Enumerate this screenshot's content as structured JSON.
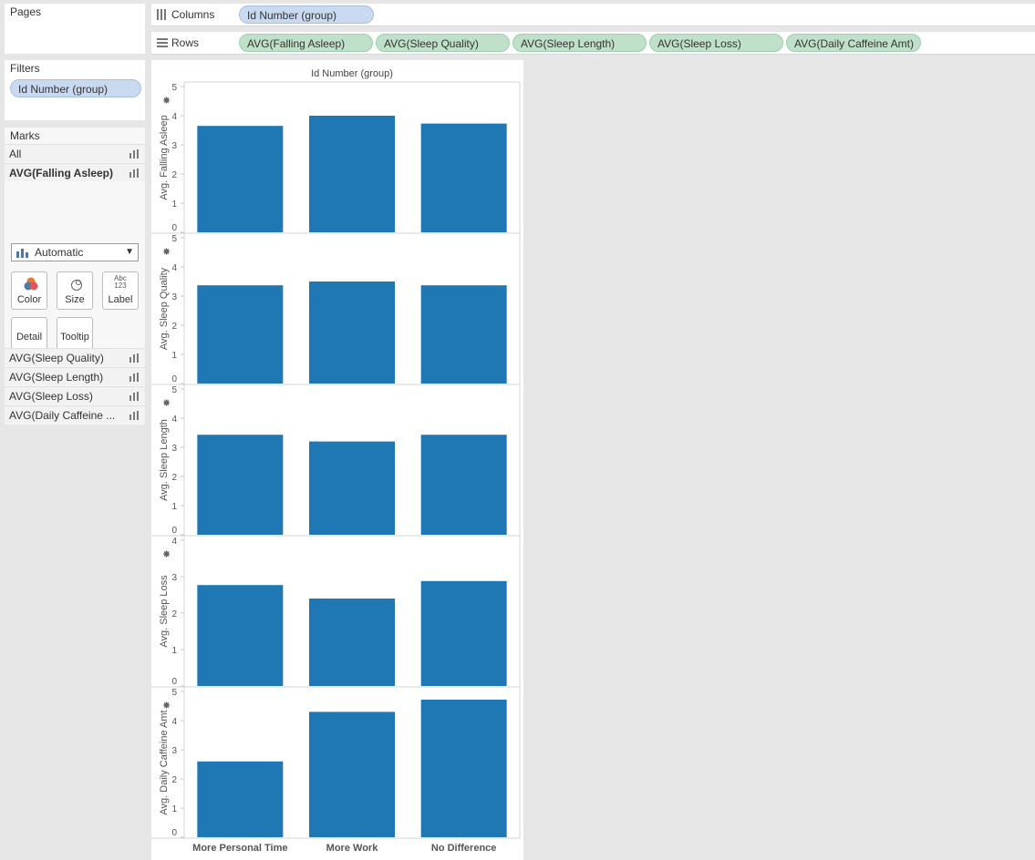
{
  "pages": {
    "title": "Pages"
  },
  "filters": {
    "title": "Filters",
    "pills": [
      "Id Number (group)"
    ]
  },
  "marks": {
    "title": "Marks",
    "rows_top": [
      "All",
      "AVG(Falling Asleep)"
    ],
    "mark_type": "Automatic",
    "buttons": {
      "color": "Color",
      "size": "Size",
      "label": "Label",
      "label_glyph_top": "Abc",
      "label_glyph_bottom": "123",
      "detail": "Detail",
      "tooltip": "Tooltip"
    },
    "rows_bottom": [
      "AVG(Sleep Quality)",
      "AVG(Sleep Length)",
      "AVG(Sleep Loss)",
      "AVG(Daily Caffeine ..."
    ]
  },
  "columns_shelf": {
    "label": "Columns",
    "pills": [
      "Id Number (group)"
    ]
  },
  "rows_shelf": {
    "label": "Rows",
    "pills": [
      "AVG(Falling Asleep)",
      "AVG(Sleep Quality)",
      "AVG(Sleep Length)",
      "AVG(Sleep Loss)",
      "AVG(Daily Caffeine Amt)"
    ]
  },
  "colors": {
    "bar": "#1f77b4",
    "blue_pill": "#c9daf0",
    "green_pill": "#bfe0c9"
  },
  "chart_data": {
    "type": "bar",
    "title": "Id Number (group)",
    "categories": [
      "More Personal Time",
      "More Work",
      "No Difference"
    ],
    "series": [
      {
        "name": "Avg. Falling Asleep",
        "values": [
          3.65,
          4.0,
          3.73
        ],
        "ylim": [
          0,
          5
        ],
        "ticks": [
          0,
          1,
          2,
          3,
          4,
          5
        ]
      },
      {
        "name": "Avg. Sleep Quality",
        "values": [
          3.37,
          3.5,
          3.37
        ],
        "ylim": [
          0,
          5
        ],
        "ticks": [
          0,
          1,
          2,
          3,
          4,
          5
        ]
      },
      {
        "name": "Avg. Sleep Length",
        "values": [
          3.43,
          3.2,
          3.43
        ],
        "ylim": [
          0,
          5
        ],
        "ticks": [
          0,
          1,
          2,
          3,
          4,
          5
        ]
      },
      {
        "name": "Avg. Sleep Loss",
        "values": [
          2.77,
          2.4,
          2.88
        ],
        "ylim": [
          0,
          4
        ],
        "ticks": [
          0,
          1,
          2,
          3,
          4
        ]
      },
      {
        "name": "Avg. Daily Caffeine Amt",
        "values": [
          2.6,
          4.3,
          4.72
        ],
        "ylim": [
          0,
          5
        ],
        "ticks": [
          0,
          1,
          2,
          3,
          4,
          5
        ]
      }
    ]
  }
}
